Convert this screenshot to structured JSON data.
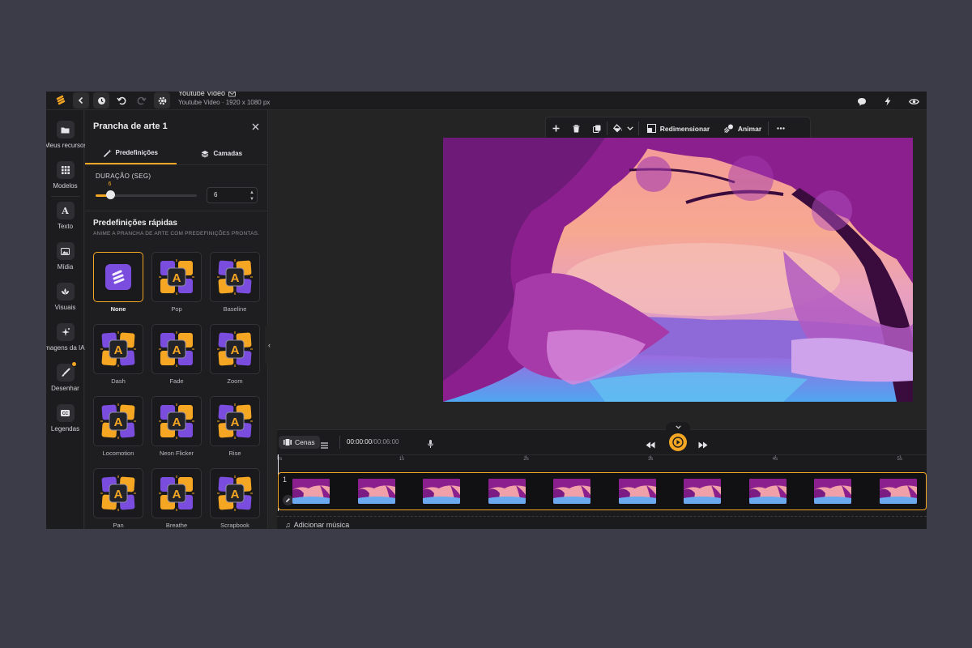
{
  "app": {
    "title": "Youtube Video",
    "subtitle": "Youtube Video · 1920 x 1080 px"
  },
  "rail": {
    "items": [
      {
        "label": "Meus recursos",
        "icon": "folder-icon"
      },
      {
        "label": "Modelos",
        "icon": "grid-icon"
      },
      {
        "label": "Texto",
        "icon": "text-icon"
      },
      {
        "label": "Mídia",
        "icon": "image-icon"
      },
      {
        "label": "Visuais",
        "icon": "shapes-icon"
      },
      {
        "label": "Imagens da IA",
        "icon": "ai-sparkle-icon"
      },
      {
        "label": "Desenhar",
        "icon": "brush-icon"
      },
      {
        "label": "Legendas",
        "icon": "captions-icon"
      }
    ]
  },
  "panel": {
    "title": "Prancha de arte 1",
    "tabs": [
      "Predefinições",
      "Camadas"
    ],
    "duration_label": "DURAÇÃO (SEG)",
    "duration_value": "6",
    "duration_fraction": 0.14,
    "quick_title": "Predefinições rápidas",
    "quick_subtitle": "ANIME A PRANCHA DE ARTE COM PREDEFINIÇÕES PRONTAS.",
    "presets": [
      "None",
      "Pop",
      "Baseline",
      "Dash",
      "Fade",
      "Zoom",
      "Locomotion",
      "Neon Flicker",
      "Rise",
      "Pan",
      "Breathe",
      "Scrapbook"
    ],
    "selected_preset": "None"
  },
  "toolbar": {
    "resize_label": "Redimensionar",
    "animate_label": "Animar"
  },
  "timeline": {
    "scenes_label": "Cenas",
    "current_time": "00:00:00",
    "total_time": "/00:06:00",
    "ticks": [
      "0s",
      "1s",
      "2s",
      "3s",
      "4s",
      "5s"
    ],
    "track_number": "1",
    "add_music": "Adicionar música",
    "thumbnail_count": 10
  },
  "colors": {
    "accent": "#f5a623",
    "preset_purple": "#7b4dde"
  }
}
